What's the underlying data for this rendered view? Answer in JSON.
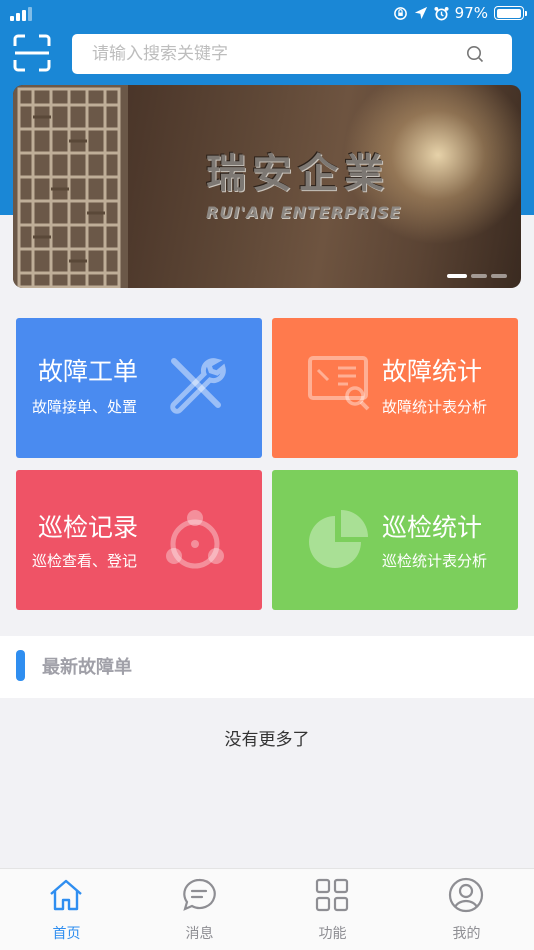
{
  "status_bar": {
    "battery_text": "97%",
    "icons": [
      "signal-icon",
      "screen-lock-icon",
      "location-arrow-icon",
      "alarm-icon",
      "battery-icon"
    ]
  },
  "header": {
    "scan_icon": "scan-icon",
    "search_placeholder": "请输入搜索关键字",
    "search_icon": "search-icon"
  },
  "banner": {
    "title_cn": "瑞安企業",
    "title_en": "RUI'AN ENTERPRISE",
    "slide_count": 3,
    "active_slide": 1
  },
  "tiles": [
    {
      "title": "故障工单",
      "subtitle": "故障接单、处置",
      "icon": "wrench-screwdriver-icon",
      "color": "#4a8bf0"
    },
    {
      "title": "故障统计",
      "subtitle": "故障统计表分析",
      "icon": "report-magnifier-icon",
      "color": "#ff7a4d"
    },
    {
      "title": "巡检记录",
      "subtitle": "巡检查看、登记",
      "icon": "inspection-network-icon",
      "color": "#ef5366"
    },
    {
      "title": "巡检统计",
      "subtitle": "巡检统计表分析",
      "icon": "pie-chart-icon",
      "color": "#7ccf5c"
    }
  ],
  "section": {
    "title": "最新故障单",
    "empty_text": "没有更多了"
  },
  "tabbar": {
    "items": [
      {
        "label": "首页",
        "icon": "home-icon",
        "active": true
      },
      {
        "label": "消息",
        "icon": "message-icon",
        "active": false
      },
      {
        "label": "功能",
        "icon": "grid-apps-icon",
        "active": false
      },
      {
        "label": "我的",
        "icon": "user-profile-icon",
        "active": false
      }
    ],
    "active_color": "#2f8ef0"
  },
  "colors": {
    "header_blue": "#1a87d6",
    "accent_blue": "#2f8ef0"
  }
}
